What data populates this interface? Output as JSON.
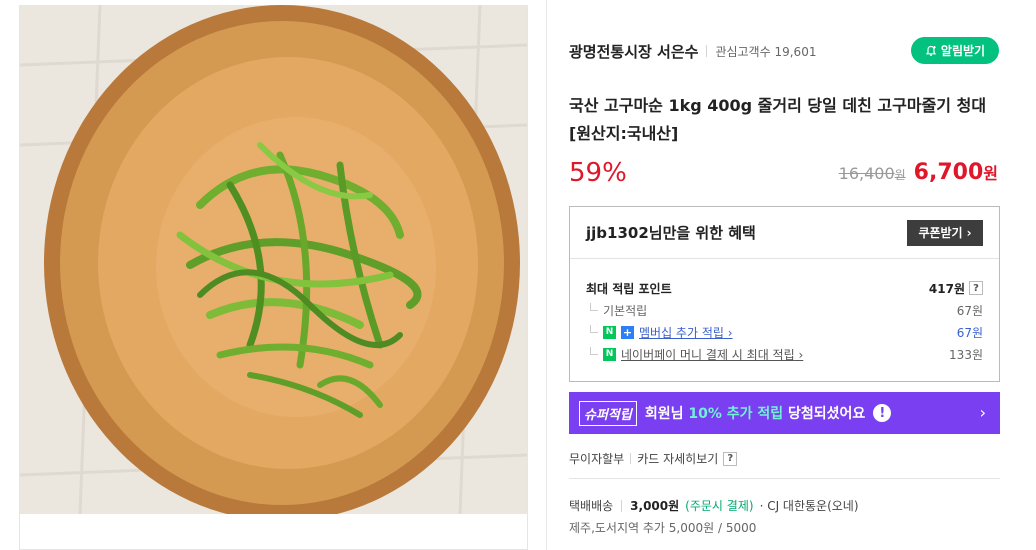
{
  "store": {
    "name": "광명전통시장 서은수",
    "interest_label": "관심고객수",
    "interest_count": "19,601",
    "alarm_label": "알림받기"
  },
  "product": {
    "title": "국산 고구마순 1kg 400g 줄거리 당일 데친 고구마줄기 청대 [원산지:국내산]",
    "discount": "59%",
    "original_price": "16,400",
    "original_unit": "원",
    "sale_price": "6,700",
    "sale_unit": "원"
  },
  "benefit": {
    "title": "jjb1302님만을 위한 혜택",
    "coupon_label": "쿠폰받기",
    "points": {
      "max_label": "최대 적립 포인트",
      "max_value": "417원",
      "help": "?",
      "rows": [
        {
          "label": "기본적립",
          "value": "67원"
        },
        {
          "label": "멤버십 추가 적립",
          "value": "67원",
          "badge_n": "N",
          "badge_plus": "+"
        },
        {
          "label": "네이버페이 머니 결제 시 최대 적립",
          "value": "133원",
          "badge_n": "N"
        }
      ]
    }
  },
  "super_banner": {
    "tag": "슈퍼적립",
    "text_before": "회원님",
    "text_highlight": "10% 추가 적립",
    "text_after": "당첨되셨어요",
    "excl": "!",
    "arrow": "›"
  },
  "installment": {
    "label": "무이자할부",
    "card_label": "카드 자세히보기",
    "help": "?"
  },
  "shipping": {
    "label": "택배배송",
    "fee": "3,000원",
    "fee_note": "(주문시 결제)",
    "carrier": "· CJ 대한통운(오네)",
    "extra": "제주,도서지역 추가 5,000원 / 5000"
  },
  "colors": {
    "accent_green": "#03c17e",
    "price_red": "#e0162b",
    "super_purple": "#7a3ff0"
  }
}
